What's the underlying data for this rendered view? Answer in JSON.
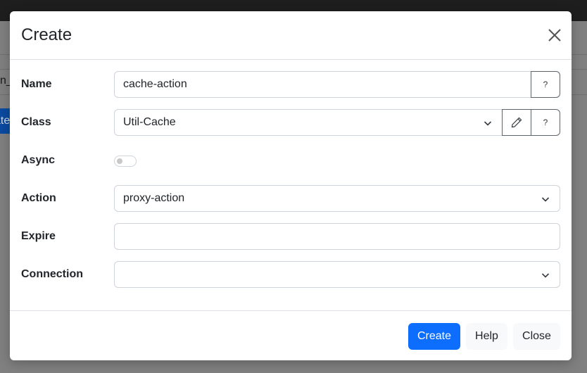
{
  "background": {
    "partial_text": "n_",
    "partial_button": "ate"
  },
  "modal": {
    "title": "Create",
    "close_icon": "close-icon"
  },
  "form": {
    "name": {
      "label": "Name",
      "value": "cache-action",
      "help": "?"
    },
    "class": {
      "label": "Class",
      "value": "Util-Cache",
      "edit_icon": "pencil-icon",
      "help": "?"
    },
    "async": {
      "label": "Async",
      "checked": false
    },
    "action": {
      "label": "Action",
      "value": "proxy-action"
    },
    "expire": {
      "label": "Expire",
      "value": ""
    },
    "connection": {
      "label": "Connection",
      "value": ""
    }
  },
  "footer": {
    "create_label": "Create",
    "help_label": "Help",
    "close_label": "Close"
  },
  "colors": {
    "primary": "#0d6efd",
    "light_button": "#f8f9fa",
    "border": "#ced4da"
  }
}
